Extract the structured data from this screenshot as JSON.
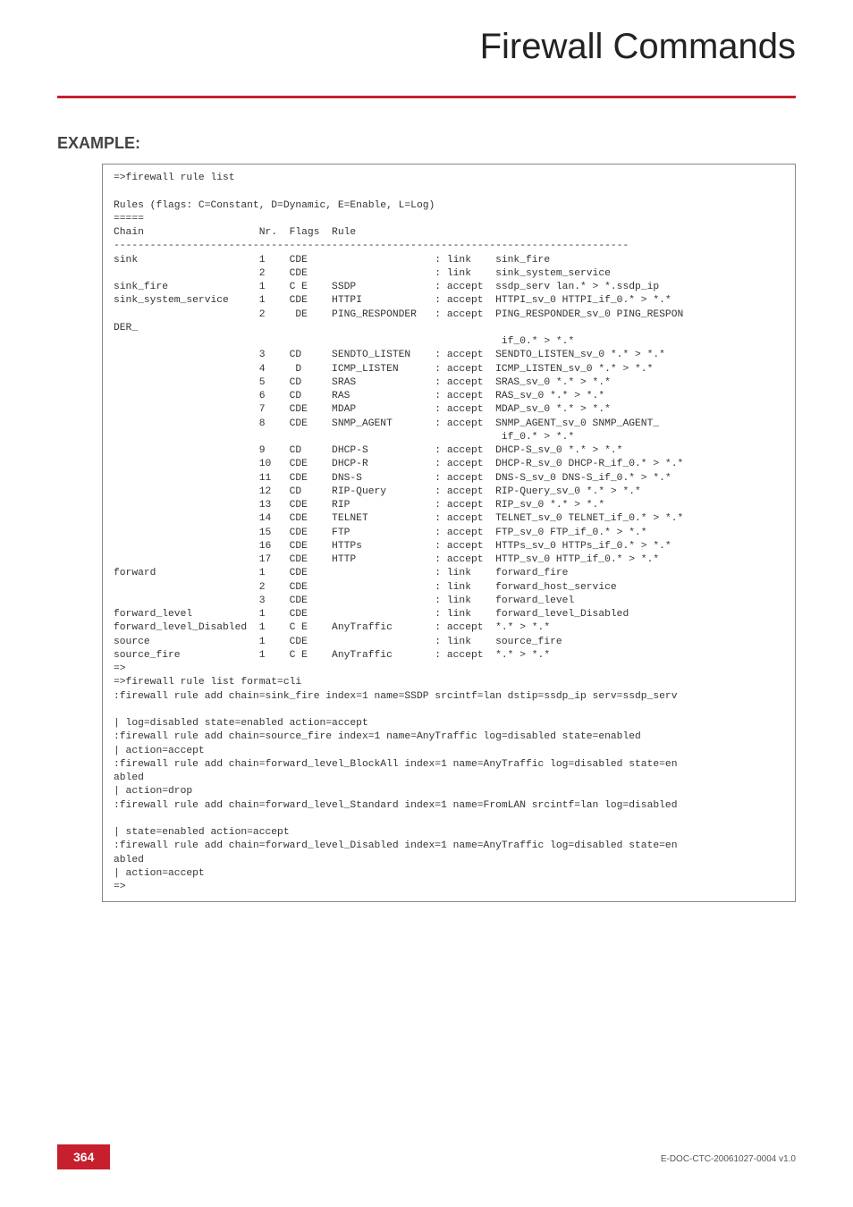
{
  "header": {
    "title": "Firewall Commands"
  },
  "section": {
    "label": "EXAMPLE:"
  },
  "code": "=>firewall rule list\n\nRules (flags: C=Constant, D=Dynamic, E=Enable, L=Log)\n=====\nChain                   Nr.  Flags  Rule\n-------------------------------------------------------------------------------------\nsink                    1    CDE                     : link    sink_fire\n                        2    CDE                     : link    sink_system_service\nsink_fire               1    C E    SSDP             : accept  ssdp_serv lan.* > *.ssdp_ip\nsink_system_service     1    CDE    HTTPI            : accept  HTTPI_sv_0 HTTPI_if_0.* > *.*\n                        2     DE    PING_RESPONDER   : accept  PING_RESPONDER_sv_0 PING_RESPON\nDER_\n                                                                if_0.* > *.*\n                        3    CD     SENDTO_LISTEN    : accept  SENDTO_LISTEN_sv_0 *.* > *.*\n                        4     D     ICMP_LISTEN      : accept  ICMP_LISTEN_sv_0 *.* > *.*\n                        5    CD     SRAS             : accept  SRAS_sv_0 *.* > *.*\n                        6    CD     RAS              : accept  RAS_sv_0 *.* > *.*\n                        7    CDE    MDAP             : accept  MDAP_sv_0 *.* > *.*\n                        8    CDE    SNMP_AGENT       : accept  SNMP_AGENT_sv_0 SNMP_AGENT_\n                                                                if_0.* > *.*\n                        9    CD     DHCP-S           : accept  DHCP-S_sv_0 *.* > *.*\n                        10   CDE    DHCP-R           : accept  DHCP-R_sv_0 DHCP-R_if_0.* > *.*\n                        11   CDE    DNS-S            : accept  DNS-S_sv_0 DNS-S_if_0.* > *.*\n                        12   CD     RIP-Query        : accept  RIP-Query_sv_0 *.* > *.*\n                        13   CDE    RIP              : accept  RIP_sv_0 *.* > *.*\n                        14   CDE    TELNET           : accept  TELNET_sv_0 TELNET_if_0.* > *.*\n                        15   CDE    FTP              : accept  FTP_sv_0 FTP_if_0.* > *.*\n                        16   CDE    HTTPs            : accept  HTTPs_sv_0 HTTPs_if_0.* > *.*\n                        17   CDE    HTTP             : accept  HTTP_sv_0 HTTP_if_0.* > *.*\nforward                 1    CDE                     : link    forward_fire\n                        2    CDE                     : link    forward_host_service\n                        3    CDE                     : link    forward_level\nforward_level           1    CDE                     : link    forward_level_Disabled\nforward_level_Disabled  1    C E    AnyTraffic       : accept  *.* > *.*\nsource                  1    CDE                     : link    source_fire\nsource_fire             1    C E    AnyTraffic       : accept  *.* > *.*\n=>\n=>firewall rule list format=cli\n:firewall rule add chain=sink_fire index=1 name=SSDP srcintf=lan dstip=ssdp_ip serv=ssdp_serv\n\n| log=disabled state=enabled action=accept\n:firewall rule add chain=source_fire index=1 name=AnyTraffic log=disabled state=enabled\n| action=accept\n:firewall rule add chain=forward_level_BlockAll index=1 name=AnyTraffic log=disabled state=en\nabled\n| action=drop\n:firewall rule add chain=forward_level_Standard index=1 name=FromLAN srcintf=lan log=disabled\n\n| state=enabled action=accept\n:firewall rule add chain=forward_level_Disabled index=1 name=AnyTraffic log=disabled state=en\nabled\n| action=accept\n=>",
  "footer": {
    "page_number": "364",
    "doc_id": "E-DOC-CTC-20061027-0004 v1.0"
  }
}
